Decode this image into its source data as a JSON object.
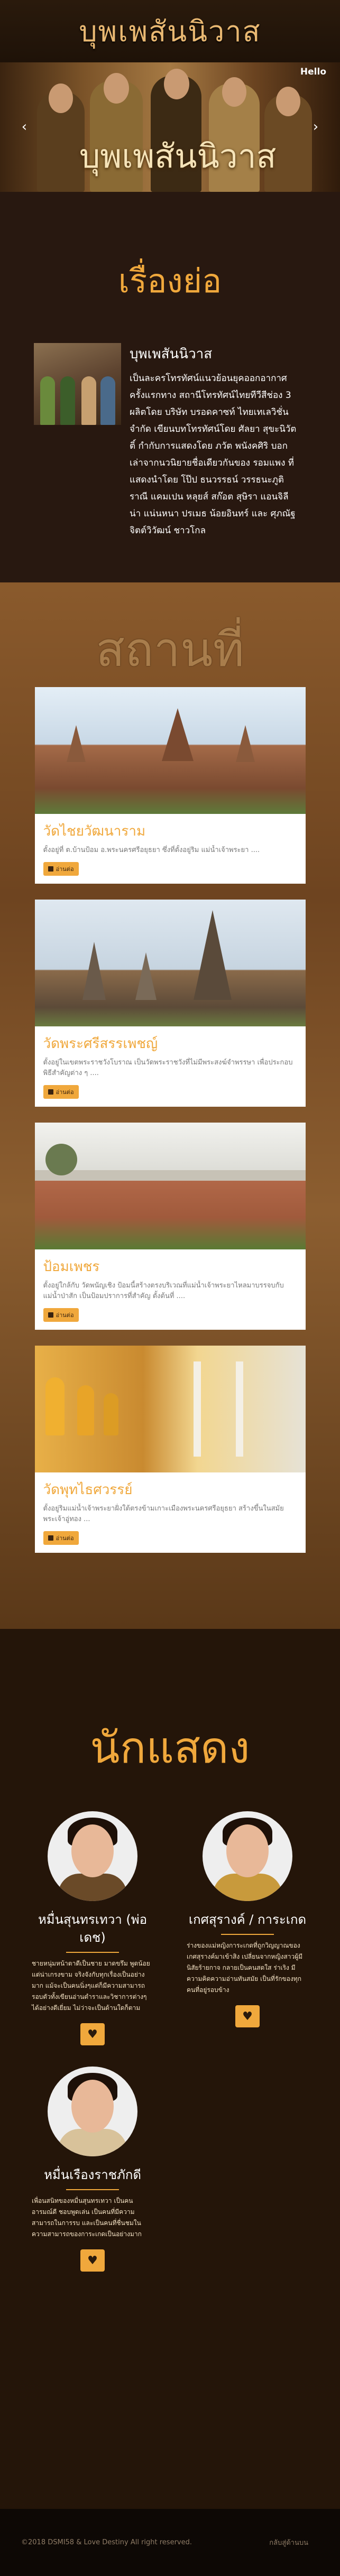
{
  "header": {
    "logo_text": "บุพเพสันนิวาส"
  },
  "hero": {
    "caption": "บุพเพสันนิวาส",
    "channel_logo": "Hello",
    "prev_icon": "chevron-left-icon",
    "next_icon": "chevron-right-icon"
  },
  "synopsis": {
    "title": "เรื่องย่อ",
    "heading": "บุพเพสันนิวาส",
    "body": "เป็นละครโทรทัศน์แนวย้อนยุคออกอากาศครั้งแรกทาง สถานีโทรทัศน์ไทยทีวีสีช่อง 3 ผลิตโดย บริษัท บรอดคาซท์ ไทยเทเลวิชั่น จำกัด เขียนบทโทรทัศน์โดย ศัลยา สุขะนิวัตติ์ กำกับการแสดงโดย ภวัต พนังคศิริ บอกเล่าจากนวนิยายชื่อเดียวกันของ รอมแพง ที่แสดงนำโดย โป๊ป ธนวรรธน์ วรรธนะภูติ ราณี แคมเปน หลุยส์ สก๊อต สุษิรา แอนจิลีน่า แน่นหนา ปรเมธ น้อยอินทร์ และ ศุภณัฐ จิตต์วิวัฒน์ ชาวโกล"
  },
  "places": {
    "title": "สถานที่",
    "read_more": "อ่านต่อ",
    "items": [
      {
        "name": "วัดไชยวัฒนาราม",
        "desc": "ตั้งอยู่ที่ ต.บ้านป้อม อ.พระนครศรีอยุธยา ซึ่งที่ตั้งอยู่ริม แม่น้ำเจ้าพระยา ...."
      },
      {
        "name": "วัดพระศรีสรรเพชญ์",
        "desc": "ตั้งอยู่ในเขตพระราชวังโบราณ เป็นวัดพระราชวังที่ไม่มีพระสงฆ์จำพรรษา เพื่อประกอบพิธีสำคัญต่าง ๆ ...."
      },
      {
        "name": "ป้อมเพชร",
        "desc": "ตั้งอยู่ใกล้กับ วัดพนัญเชิง ป้อมนี้สร้างตรงบริเวณที่แม่น้ำเจ้าพระยาไหลมาบรรจบกับแม่น้ำป่าสัก เป็นป้อมปราการที่สำคัญ ตั้งต้นที่ ...."
      },
      {
        "name": "วัดพุทไธศวรรย์",
        "desc": "ตั้งอยู่ริมแม่น้ำเจ้าพระยาฝั่งใต้ตรงข้ามเกาะเมืองพระนครศรีอยุธยา สร้างขึ้นในสมัยพระเจ้าอู่ทอง ..."
      }
    ]
  },
  "cast": {
    "title": "นักแสดง",
    "members": [
      {
        "name": "หมื่นสุนทรเทวา (พ่อเดช)",
        "bio": "ชายหนุ่มหน้าตาดีเป็นชาย มาดขรึม พูดน้อยแต่น่าเกรงขาม จริงจังกับทุกเรื่องเป็นอย่างมาก แม้จะเป็นคนนิ่งๆแต่ก็มีความสามารถรอบตัวทั้งเขียนอ่านตำราและวิชาการต่างๆ ได้อย่างดีเยี่ยม ไม่ว่าจะเป็นด้านใดก็ตาม"
      },
      {
        "name": "เกศสุรางค์ / การะเกด",
        "bio": "ร่างของแม่หญิงการะเกดที่ถูกวิญญาณของเกศสุรางค์มาเข้าสิง เปลี่ยนจากหญิงสาวผู้มีนิสัยร้ายกาจ กลายเป็นคนสดใส ร่าเริง มีความคิดความอ่านทันสมัย เป็นที่รักของทุกคนที่อยู่รอบข้าง"
      },
      {
        "name": "หมื่นเรืองราชภักดี",
        "bio": "เพื่อนสนิทของหมื่นสุนทรเทวา เป็นคนอารมณ์ดี ชอบพูดเล่น เป็นคนที่มีความสามารถในการรบ และเป็นคนที่ชื่นชมในความสามารถของการะเกดเป็นอย่างมาก"
      }
    ]
  },
  "footer": {
    "copyright": "©2018 DSMI58 & Love Destiny All right reserved.",
    "right_text": "กลับสู่ด้านบน"
  }
}
